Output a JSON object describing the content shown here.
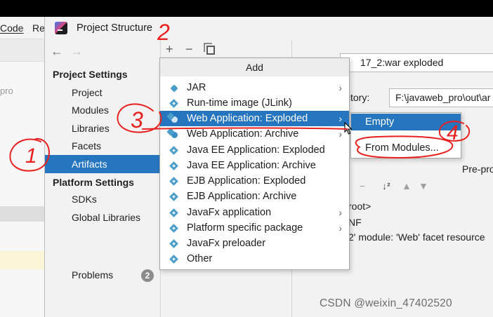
{
  "background_ide": {
    "menu": [
      "Code",
      "Re"
    ],
    "tree_hint": "pro"
  },
  "dialog": {
    "title": "Project Structure",
    "nav": {
      "back": "←",
      "forward": "→"
    }
  },
  "sidebar": {
    "project_settings_header": "Project Settings",
    "project_settings_items": [
      {
        "label": "Project"
      },
      {
        "label": "Modules"
      },
      {
        "label": "Libraries"
      },
      {
        "label": "Facets"
      },
      {
        "label": "Artifacts",
        "selected": true
      }
    ],
    "platform_settings_header": "Platform Settings",
    "platform_settings_items": [
      {
        "label": "SDKs"
      },
      {
        "label": "Global Libraries"
      }
    ],
    "problems": {
      "label": "Problems",
      "count": "2"
    }
  },
  "toolbar": {
    "add": "+",
    "remove": "−"
  },
  "add_menu": {
    "header": "Add",
    "items": [
      {
        "label": "JAR",
        "icon": "jar-icon",
        "has_submenu": true
      },
      {
        "label": "Run-time image (JLink)",
        "icon": "diamond-icon",
        "has_submenu": false
      },
      {
        "label": "Web Application: Exploded",
        "icon": "web-app-icon",
        "has_submenu": true,
        "highlighted": true
      },
      {
        "label": "Web Application: Archive",
        "icon": "web-app-icon",
        "has_submenu": true
      },
      {
        "label": "Java EE Application: Exploded",
        "icon": "diamond-icon",
        "has_submenu": false
      },
      {
        "label": "Java EE Application: Archive",
        "icon": "diamond-icon",
        "has_submenu": false
      },
      {
        "label": "EJB Application: Exploded",
        "icon": "diamond-icon",
        "has_submenu": false
      },
      {
        "label": "EJB Application: Archive",
        "icon": "diamond-icon",
        "has_submenu": false
      },
      {
        "label": "JavaFx application",
        "icon": "diamond-icon",
        "has_submenu": true
      },
      {
        "label": "Platform specific package",
        "icon": "diamond-icon",
        "has_submenu": true
      },
      {
        "label": "JavaFx preloader",
        "icon": "diamond-icon",
        "has_submenu": false
      },
      {
        "label": "Other",
        "icon": "diamond-icon",
        "has_submenu": false
      }
    ]
  },
  "sub_menu": {
    "items": [
      {
        "label": "Empty",
        "highlighted": true
      },
      {
        "label": "From Modules..."
      }
    ]
  },
  "right_panel": {
    "name_value": "17_2:war exploded",
    "output_dir_label": "ctory:",
    "output_dir_value": "F:\\javaweb_pro\\out\\ar",
    "pre_processing": "Pre-pro",
    "tree_lines": [
      "root>",
      "NF",
      "2' module: 'Web' facet resource"
    ]
  },
  "annotations": [
    "1",
    "2",
    "3",
    "4"
  ],
  "watermark": "CSDN @weixin_47402520",
  "colors": {
    "selection": "#2675bf",
    "annotation": "#e8211f"
  }
}
